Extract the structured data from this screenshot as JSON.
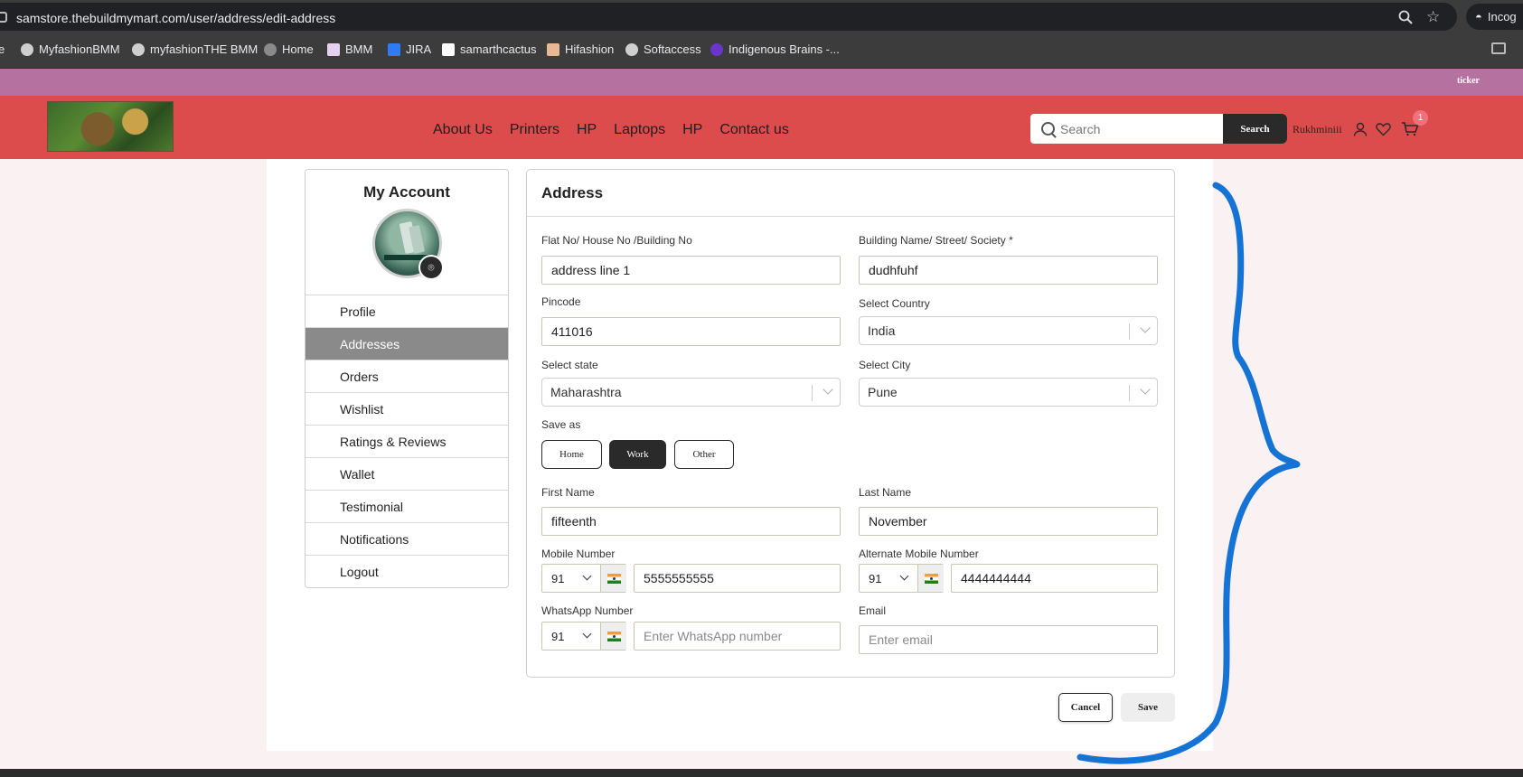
{
  "browser": {
    "url": "samstore.thebuildmymart.com/user/address/edit-address",
    "profile_label": "Incog",
    "bookmarks": [
      {
        "label": "e"
      },
      {
        "label": "MyfashionBMM"
      },
      {
        "label": "myfashionTHE BMM"
      },
      {
        "label": "Home"
      },
      {
        "label": "BMM"
      },
      {
        "label": "JIRA"
      },
      {
        "label": "samarthcactus"
      },
      {
        "label": "Hifashion"
      },
      {
        "label": "Softaccess"
      },
      {
        "label": "Indigenous Brains -..."
      }
    ]
  },
  "site": {
    "ticker": "ticker",
    "nav": [
      "About Us",
      "Printers",
      "HP",
      "Laptops",
      "HP",
      "Contact us"
    ],
    "search_placeholder": "Search",
    "search_button": "Search",
    "username": "Rukhminiii",
    "cart_count": "1",
    "colors": {
      "ticker": "#b5719f",
      "header": "#dc4c4c",
      "active_menu": "#8a8a8a"
    }
  },
  "sidebar": {
    "title": "My Account",
    "items": [
      {
        "label": "Profile"
      },
      {
        "label": "Addresses"
      },
      {
        "label": "Orders"
      },
      {
        "label": "Wishlist"
      },
      {
        "label": "Ratings & Reviews"
      },
      {
        "label": "Wallet"
      },
      {
        "label": "Testimonial"
      },
      {
        "label": "Notifications"
      },
      {
        "label": "Logout"
      }
    ],
    "active_item": "Addresses"
  },
  "form": {
    "title": "Address",
    "flat": {
      "label": "Flat No/ House No /Building No",
      "value": "address line 1"
    },
    "building": {
      "label": "Building Name/ Street/ Society *",
      "value": "dudhfuhf"
    },
    "pincode": {
      "label": "Pincode",
      "value": "411016"
    },
    "country": {
      "label": "Select Country",
      "value": "India"
    },
    "state": {
      "label": "Select state",
      "value": "Maharashtra"
    },
    "city": {
      "label": "Select City",
      "value": "Pune"
    },
    "save_as": {
      "label": "Save as",
      "options": [
        "Home",
        "Work",
        "Other"
      ],
      "selected": "Work"
    },
    "first_name": {
      "label": "First Name",
      "value": "fifteenth"
    },
    "last_name": {
      "label": "Last Name",
      "value": "November"
    },
    "mobile": {
      "label": "Mobile Number",
      "code": "91",
      "value": "5555555555"
    },
    "alt_mobile": {
      "label": "Alternate Mobile Number",
      "code": "91",
      "value": "4444444444"
    },
    "whatsapp": {
      "label": "WhatsApp Number",
      "code": "91",
      "placeholder": "Enter WhatsApp number"
    },
    "email": {
      "label": "Email",
      "placeholder": "Enter email"
    },
    "cancel_label": "Cancel",
    "save_label": "Save"
  }
}
